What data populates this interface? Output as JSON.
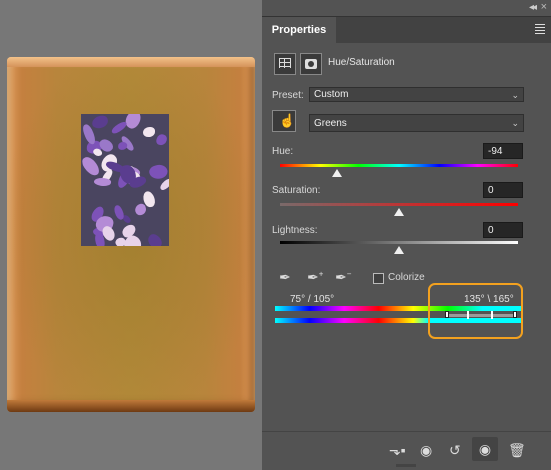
{
  "panel": {
    "tab_label": "Properties",
    "adjustment_title": "Hue/Saturation",
    "preset_label": "Preset:",
    "preset_value": "Custom",
    "channel_value": "Greens",
    "hue_label": "Hue:",
    "hue_value": "-94",
    "saturation_label": "Saturation:",
    "saturation_value": "0",
    "lightness_label": "Lightness:",
    "lightness_value": "0",
    "colorize_label": "Colorize",
    "range_left": "75° /  105°",
    "range_right": "135° \\ 165°",
    "hue_slider_value": -94,
    "saturation_slider_value": 0,
    "lightness_slider_value": 0
  },
  "icons": {
    "collapse": "double-chevron-left-icon",
    "menu": "hamburger-menu-icon",
    "adjustment": "hue-saturation-adjustment-icon",
    "mask": "layer-mask-icon",
    "hand": "targeted-adjustment-hand-icon",
    "eyedropper": "eyedropper-icon",
    "eyedropper_plus": "eyedropper-add-icon",
    "eyedropper_minus": "eyedropper-subtract-icon",
    "clip": "clip-to-layer-icon",
    "view_previous": "view-previous-state-icon",
    "reset": "reset-icon",
    "visibility": "eye-icon",
    "delete": "trash-icon"
  },
  "colors": {
    "highlight": "#f3a11f",
    "panel_bg": "#535353",
    "canvas_bg": "#777777"
  }
}
